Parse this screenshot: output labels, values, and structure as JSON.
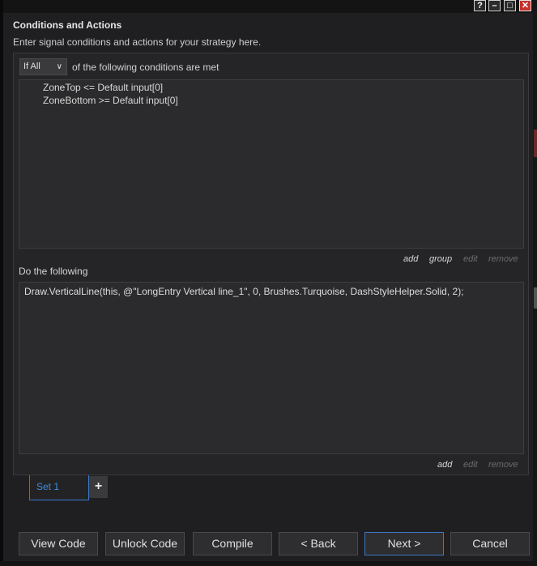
{
  "window": {
    "buttons": [
      "?",
      "–",
      "□",
      "✕"
    ]
  },
  "section": {
    "title": "Conditions and Actions",
    "description": "Enter signal conditions and actions for your strategy here."
  },
  "conditions": {
    "match_select": "If All",
    "match_text": "of the following conditions are met",
    "items": [
      "ZoneTop <= Default input[0]",
      "ZoneBottom >= Default input[0]"
    ],
    "links": {
      "add": "add",
      "group": "group",
      "edit": "edit",
      "remove": "remove"
    }
  },
  "actions": {
    "label": "Do the following",
    "items": [
      "Draw.VerticalLine(this, @\"LongEntry Vertical line_1\", 0, Brushes.Turquoise, DashStyleHelper.Solid, 2);"
    ],
    "links": {
      "add": "add",
      "edit": "edit",
      "remove": "remove"
    }
  },
  "sets": {
    "tabs": [
      "Set 1"
    ],
    "add_label": "+"
  },
  "footer": {
    "view_code": "View Code",
    "unlock_code": "Unlock Code",
    "compile": "Compile",
    "back": "< Back",
    "next": "Next >",
    "cancel": "Cancel"
  },
  "colors": {
    "accent": "#3b8fe0",
    "close_button": "#c8302a"
  }
}
